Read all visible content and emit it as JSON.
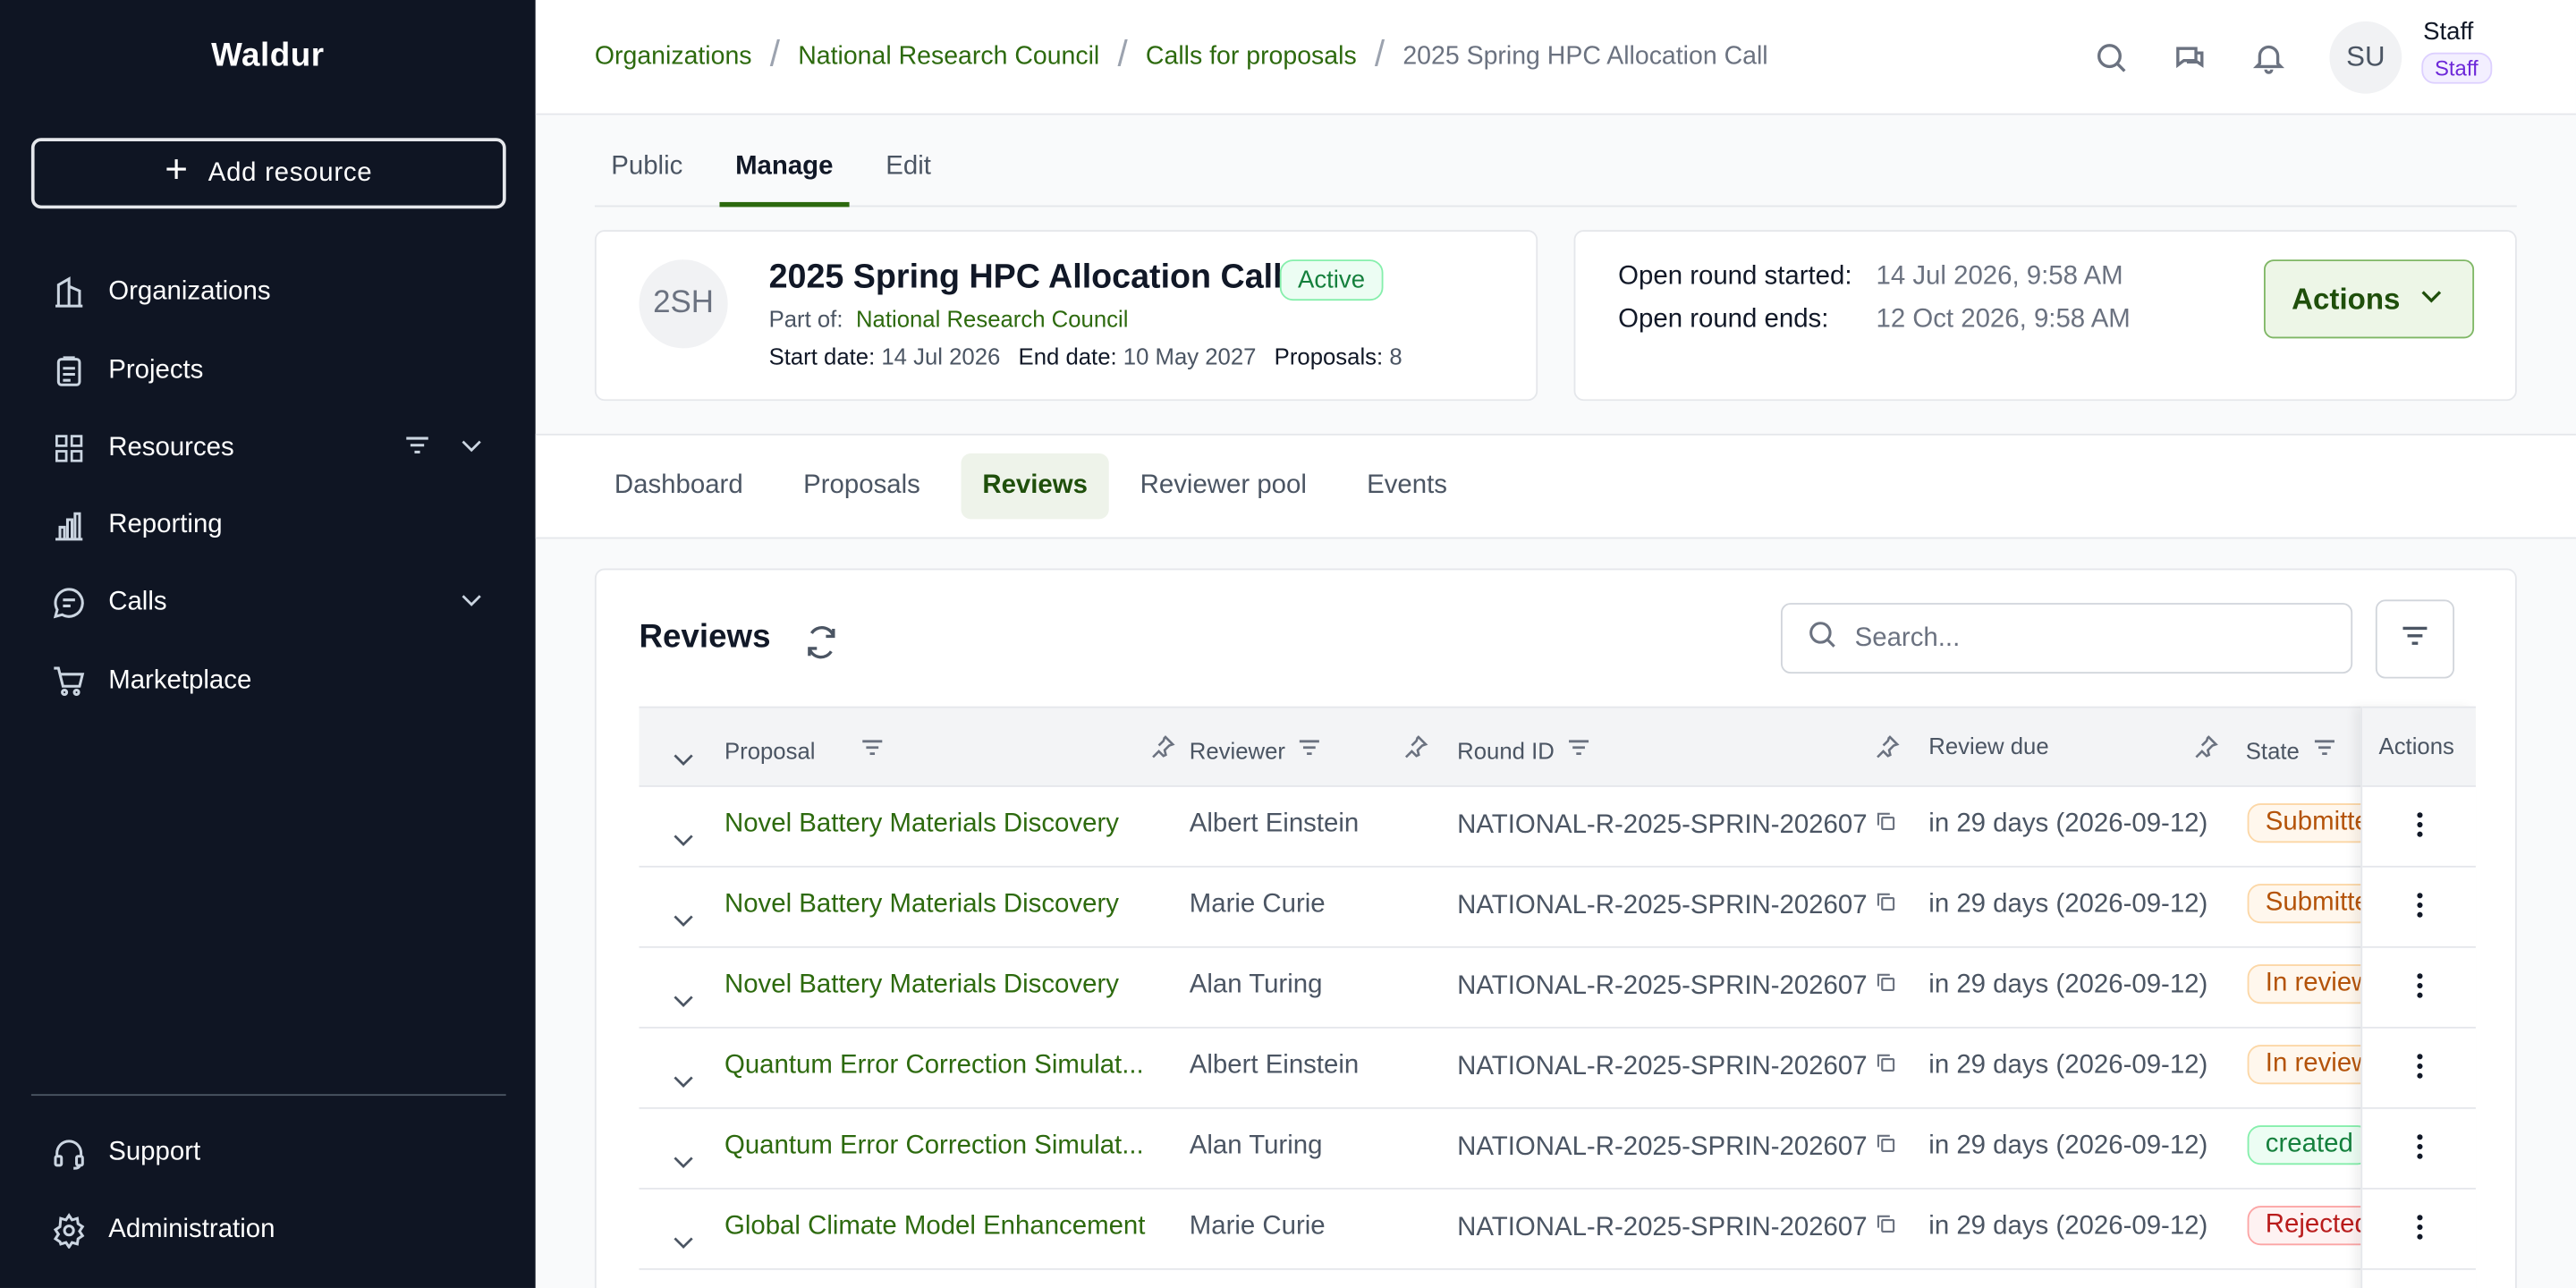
{
  "app": {
    "name": "Waldur"
  },
  "sidebar": {
    "add_resource": "Add resource",
    "items": [
      {
        "label": "Organizations",
        "icon": "building-icon"
      },
      {
        "label": "Projects",
        "icon": "clipboard-icon"
      },
      {
        "label": "Resources",
        "icon": "grid-icon"
      },
      {
        "label": "Reporting",
        "icon": "bar-chart-icon"
      },
      {
        "label": "Calls",
        "icon": "chat-icon"
      },
      {
        "label": "Marketplace",
        "icon": "cart-icon"
      }
    ],
    "bottom": [
      {
        "label": "Support",
        "icon": "headset-icon"
      },
      {
        "label": "Administration",
        "icon": "gear-icon"
      }
    ]
  },
  "header": {
    "breadcrumbs": [
      "Organizations",
      "National Research Council",
      "Calls for proposals",
      "2025 Spring HPC Allocation Call"
    ],
    "user": {
      "initials": "SU",
      "name": "Staff",
      "role": "Staff"
    }
  },
  "tabs": [
    "Public",
    "Manage",
    "Edit"
  ],
  "call": {
    "initials": "2SH",
    "title": "2025 Spring HPC Allocation Call",
    "status": "Active",
    "part_of_label": "Part of:",
    "organization": "National Research Council",
    "start_label": "Start date:",
    "start_date": "14 Jul 2026",
    "end_label": "End date:",
    "end_date": "10 May 2027",
    "proposals_label": "Proposals:",
    "proposals": "8"
  },
  "round": {
    "started_label": "Open round started:",
    "started": "14 Jul 2026, 9:58 AM",
    "ends_label": "Open round ends:",
    "ends": "12 Oct 2026, 9:58 AM",
    "actions": "Actions"
  },
  "sub_tabs": [
    "Dashboard",
    "Proposals",
    "Reviews",
    "Reviewer pool",
    "Events"
  ],
  "reviews": {
    "title": "Reviews",
    "search_placeholder": "Search...",
    "columns": [
      "Proposal",
      "Reviewer",
      "Round ID",
      "Review due",
      "State",
      "Actions"
    ],
    "rows": [
      {
        "proposal": "Novel Battery Materials Discovery",
        "reviewer": "Albert Einstein",
        "round": "NATIONAL-R-2025-SPRIN-202607",
        "due": "in 29 days (2026-09-12)",
        "state": "Submitted",
        "state_class": "submitted"
      },
      {
        "proposal": "Novel Battery Materials Discovery",
        "reviewer": "Marie Curie",
        "round": "NATIONAL-R-2025-SPRIN-202607",
        "due": "in 29 days (2026-09-12)",
        "state": "Submitted",
        "state_class": "submitted"
      },
      {
        "proposal": "Novel Battery Materials Discovery",
        "reviewer": "Alan Turing",
        "round": "NATIONAL-R-2025-SPRIN-202607",
        "due": "in 29 days (2026-09-12)",
        "state": "In review",
        "state_class": "inreview"
      },
      {
        "proposal": "Quantum Error Correction Simulat...",
        "reviewer": "Albert Einstein",
        "round": "NATIONAL-R-2025-SPRIN-202607",
        "due": "in 29 days (2026-09-12)",
        "state": "In review",
        "state_class": "inreview"
      },
      {
        "proposal": "Quantum Error Correction Simulat...",
        "reviewer": "Alan Turing",
        "round": "NATIONAL-R-2025-SPRIN-202607",
        "due": "in 29 days (2026-09-12)",
        "state": "created",
        "state_class": "created"
      },
      {
        "proposal": "Global Climate Model Enhancement",
        "reviewer": "Marie Curie",
        "round": "NATIONAL-R-2025-SPRIN-202607",
        "due": "in 29 days (2026-09-12)",
        "state": "Rejected",
        "state_class": "rejected"
      }
    ]
  }
}
